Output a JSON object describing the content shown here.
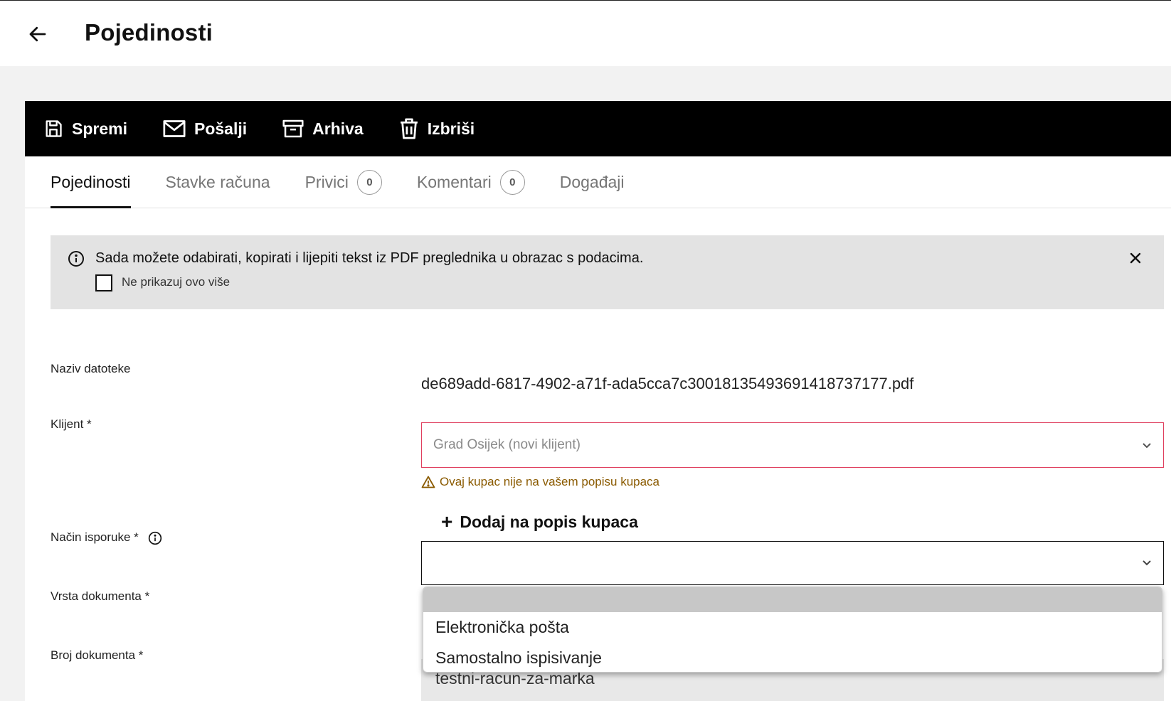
{
  "header": {
    "title": "Pojedinosti"
  },
  "toolbar": {
    "save_label": "Spremi",
    "send_label": "Pošalji",
    "archive_label": "Arhiva",
    "delete_label": "Izbriši"
  },
  "tabs": [
    {
      "label": "Pojedinosti",
      "active": true
    },
    {
      "label": "Stavke računa"
    },
    {
      "label": "Privici",
      "count": "0"
    },
    {
      "label": "Komentari",
      "count": "0"
    },
    {
      "label": "Događaji"
    }
  ],
  "notice": {
    "text": "Sada možete odabirati, kopirati i lijepiti tekst iz PDF preglednika u obrazac s podacima.",
    "checkbox_label": "Ne prikazuj ovo više"
  },
  "form": {
    "filename_label": "Naziv datoteke",
    "filename_value": "de689add-6817-4902-a71f-ada5cca7c300181354936914187371 77.pdf",
    "client_label": "Klijent *",
    "client_placeholder": "Grad Osijek (novi klijent)",
    "client_warning": "Ovaj kupac nije na vašem popisu kupaca",
    "add_client_label": "Dodaj na popis kupaca",
    "delivery_label": "Način isporuke *",
    "delivery_options": [
      "",
      "Elektronička pošta",
      "Samostalno ispisivanje"
    ],
    "doc_type_label": "Vrsta dokumenta *",
    "doc_number_label": "Broj dokumenta *",
    "doc_number_value": "testni-racun-za-marka"
  },
  "colors": {
    "accent": "#000000",
    "error_border": "#e0405f",
    "warning": "#8a5a00"
  }
}
